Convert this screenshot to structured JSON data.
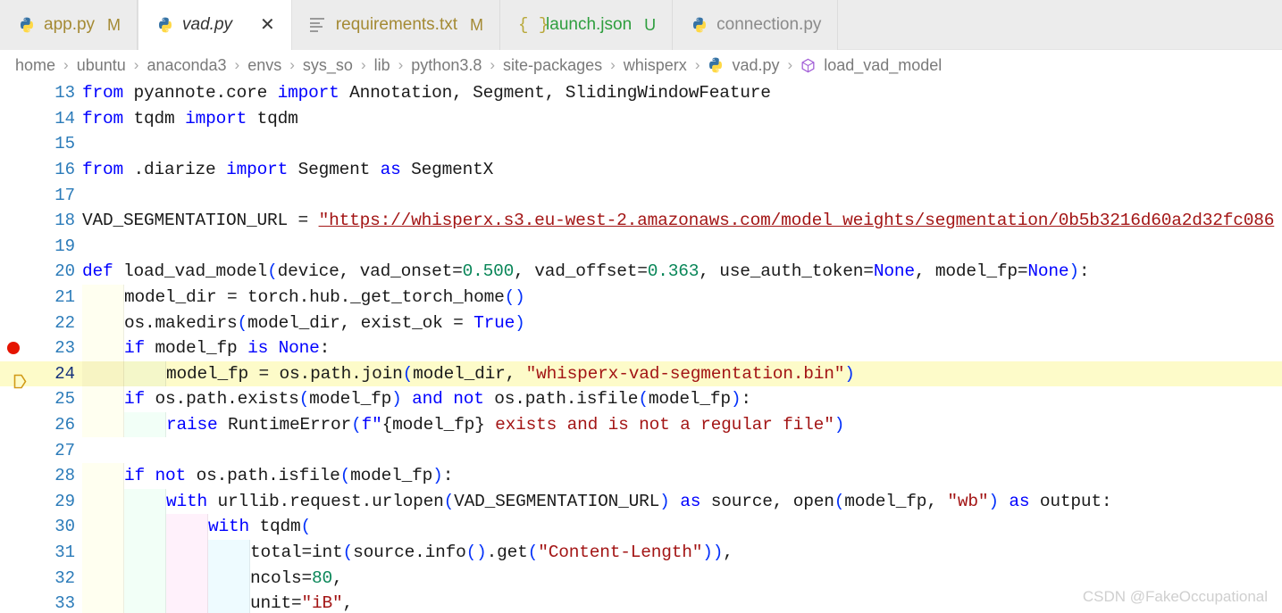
{
  "tabs": [
    {
      "label": "app.py",
      "icon": "python-icon",
      "badge": "M",
      "state": "modified",
      "active": false,
      "closable": false
    },
    {
      "label": "vad.py",
      "icon": "python-icon",
      "badge": "",
      "state": "active",
      "active": true,
      "closable": true,
      "close_glyph": "✕"
    },
    {
      "label": "requirements.txt",
      "icon": "text-file-icon",
      "badge": "M",
      "state": "modified",
      "active": false,
      "closable": false
    },
    {
      "label": "launch.json",
      "icon": "json-icon",
      "badge": "U",
      "state": "untracked",
      "active": false,
      "closable": false
    },
    {
      "label": "connection.py",
      "icon": "python-icon",
      "badge": "",
      "state": "normal",
      "active": false,
      "closable": false
    }
  ],
  "breadcrumb": {
    "separator": "›",
    "items": [
      {
        "label": "home",
        "icon": null
      },
      {
        "label": "ubuntu",
        "icon": null
      },
      {
        "label": "anaconda3",
        "icon": null
      },
      {
        "label": "envs",
        "icon": null
      },
      {
        "label": "sys_so",
        "icon": null
      },
      {
        "label": "lib",
        "icon": null
      },
      {
        "label": "python3.8",
        "icon": null
      },
      {
        "label": "site-packages",
        "icon": null
      },
      {
        "label": "whisperx",
        "icon": null
      },
      {
        "label": "vad.py",
        "icon": "python-icon"
      },
      {
        "label": "load_vad_model",
        "icon": "symbol-method-icon"
      }
    ]
  },
  "editor": {
    "first_visible_line": 13,
    "active_line": 24,
    "breakpoint_line": 23,
    "lines": [
      {
        "n": 13,
        "indent": 0,
        "text": "from pyannote.core import Annotation, Segment, SlidingWindowFeature"
      },
      {
        "n": 14,
        "indent": 0,
        "text": "from tqdm import tqdm"
      },
      {
        "n": 15,
        "indent": 0,
        "text": ""
      },
      {
        "n": 16,
        "indent": 0,
        "text": "from .diarize import Segment as SegmentX"
      },
      {
        "n": 17,
        "indent": 0,
        "text": ""
      },
      {
        "n": 18,
        "indent": 0,
        "text": "VAD_SEGMENTATION_URL = \"https://whisperx.s3.eu-west-2.amazonaws.com/model_weights/segmentation/0b5b3216d60a2d32fc086"
      },
      {
        "n": 19,
        "indent": 0,
        "text": ""
      },
      {
        "n": 20,
        "indent": 0,
        "text": "def load_vad_model(device, vad_onset=0.500, vad_offset=0.363, use_auth_token=None, model_fp=None):"
      },
      {
        "n": 21,
        "indent": 1,
        "text": "model_dir = torch.hub._get_torch_home()"
      },
      {
        "n": 22,
        "indent": 1,
        "text": "os.makedirs(model_dir, exist_ok = True)"
      },
      {
        "n": 23,
        "indent": 1,
        "text": "if model_fp is None:"
      },
      {
        "n": 24,
        "indent": 2,
        "text": "model_fp = os.path.join(model_dir, \"whisperx-vad-segmentation.bin\")"
      },
      {
        "n": 25,
        "indent": 1,
        "text": "if os.path.exists(model_fp) and not os.path.isfile(model_fp):"
      },
      {
        "n": 26,
        "indent": 2,
        "text": "raise RuntimeError(f\"{model_fp} exists and is not a regular file\")"
      },
      {
        "n": 27,
        "indent": 0,
        "text": ""
      },
      {
        "n": 28,
        "indent": 1,
        "text": "if not os.path.isfile(model_fp):"
      },
      {
        "n": 29,
        "indent": 2,
        "text": "with urllib.request.urlopen(VAD_SEGMENTATION_URL) as source, open(model_fp, \"wb\") as output:"
      },
      {
        "n": 30,
        "indent": 3,
        "text": "with tqdm("
      },
      {
        "n": 31,
        "indent": 4,
        "text": "total=int(source.info().get(\"Content-Length\")),"
      },
      {
        "n": 32,
        "indent": 4,
        "text": "ncols=80,"
      },
      {
        "n": 33,
        "indent": 4,
        "text": "unit=\"iB\","
      }
    ]
  },
  "watermark": {
    "text": "CSDN @FakeOccupational"
  },
  "colors": {
    "keyword": "#0000ff",
    "string": "#a31515",
    "number": "#098658",
    "active_line_bg": "#fdfbc9",
    "breakpoint": "#e51400",
    "line_number": "#2b7bb9",
    "tab_modified": "#a48a34",
    "tab_untracked": "#2e9e3e",
    "indent_level1": "#fffff0",
    "indent_level2": "#f2fff7",
    "indent_level3": "#fff1fb",
    "indent_level4": "#eefbff"
  }
}
